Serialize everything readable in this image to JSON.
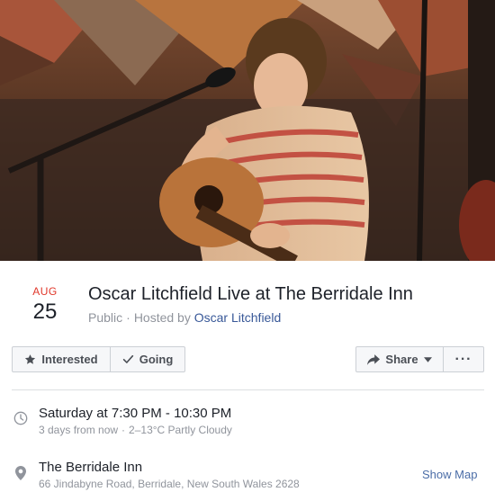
{
  "colors": {
    "accent_red": "#e0372a",
    "link_blue": "#385898",
    "text_dark": "#1d2129",
    "text_grey": "#90949c",
    "button_bg": "#f6f7f9",
    "border": "#ccd0d5"
  },
  "cover": {
    "description_icon": "event-cover-photo"
  },
  "event": {
    "month": "AUG",
    "day": "25",
    "title": "Oscar Litchfield Live at The Berridale Inn",
    "privacy": "Public",
    "separator": "·",
    "hosted_by_prefix": "Hosted by",
    "host": "Oscar Litchfield"
  },
  "actions": {
    "interested_label": "Interested",
    "interested_icon": "star-icon",
    "going_label": "Going",
    "going_icon": "check-icon",
    "share_label": "Share",
    "share_icon": "share-arrow-icon",
    "more_label": "···"
  },
  "details": {
    "time": {
      "icon": "clock-icon",
      "main": "Saturday at 7:30 PM - 10:30 PM",
      "relative": "3 days from now",
      "weather": "2–13°C Partly Cloudy"
    },
    "location": {
      "icon": "location-pin-icon",
      "venue": "The Berridale Inn",
      "address": "66 Jindabyne Road, Berridale, New South Wales 2628",
      "show_map_label": "Show Map"
    }
  }
}
